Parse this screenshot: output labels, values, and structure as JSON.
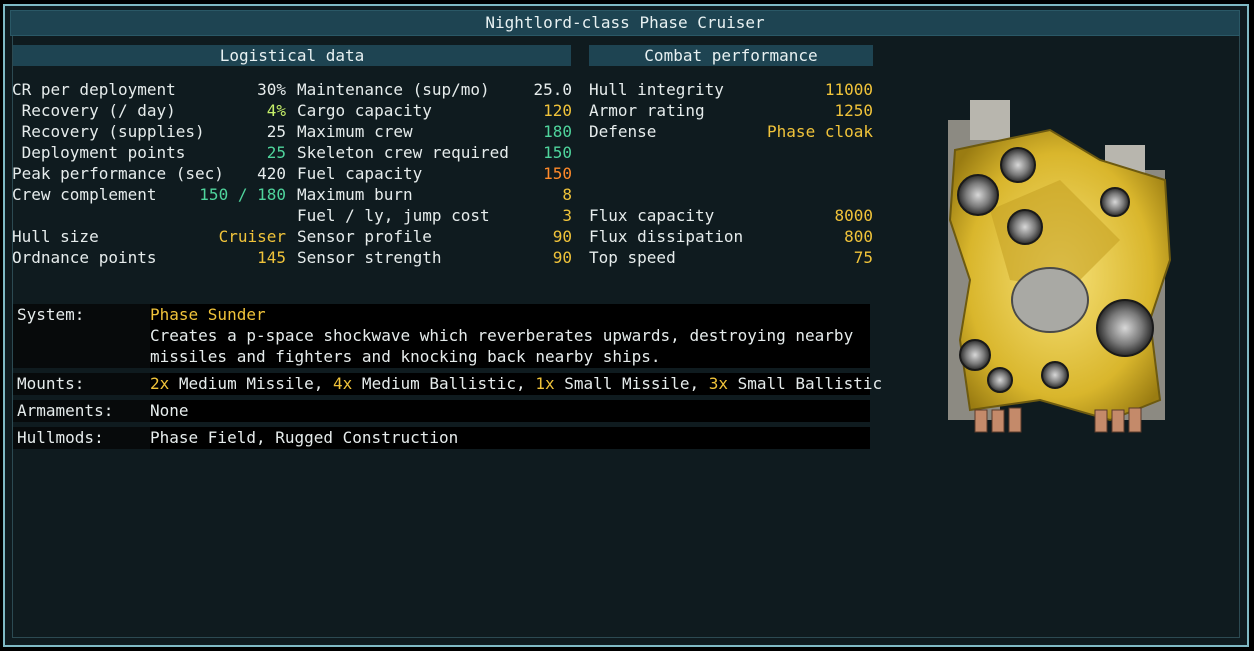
{
  "title": "Nightlord-class Phase Cruiser",
  "sections": {
    "logistical": "Logistical data",
    "combat": "Combat performance"
  },
  "col1": [
    {
      "label": "CR per deployment",
      "value": "30%",
      "color": "white"
    },
    {
      "label": " Recovery (/ day)",
      "value": "4%",
      "color": "lime"
    },
    {
      "label": " Recovery (supplies)",
      "value": "25",
      "color": "white"
    },
    {
      "label": " Deployment points",
      "value": "25",
      "color": "green"
    },
    {
      "label": "Peak performance (sec)",
      "value": "420",
      "color": "white"
    },
    {
      "label": "Crew complement",
      "value": "150 / 180",
      "color": "green"
    },
    {
      "label": "",
      "value": "",
      "color": "white"
    },
    {
      "label": "Hull size",
      "value": "Cruiser",
      "color": "yellow"
    },
    {
      "label": "Ordnance points",
      "value": "145",
      "color": "yellow"
    }
  ],
  "col2": [
    {
      "label": "Maintenance (sup/mo)",
      "value": "25.0",
      "color": "white"
    },
    {
      "label": "Cargo capacity",
      "value": "120",
      "color": "yellow"
    },
    {
      "label": "Maximum crew",
      "value": "180",
      "color": "green"
    },
    {
      "label": "Skeleton crew required",
      "value": "150",
      "color": "green"
    },
    {
      "label": "Fuel capacity",
      "value": "150",
      "color": "orange"
    },
    {
      "label": "Maximum burn",
      "value": "8",
      "color": "yellow"
    },
    {
      "label": "Fuel / ly, jump cost",
      "value": "3",
      "color": "yellow"
    },
    {
      "label": "Sensor profile",
      "value": "90",
      "color": "yellow"
    },
    {
      "label": "Sensor strength",
      "value": "90",
      "color": "yellow"
    }
  ],
  "col3": [
    {
      "label": "Hull integrity",
      "value": "11000",
      "color": "yellow"
    },
    {
      "label": "Armor rating",
      "value": "1250",
      "color": "yellow"
    },
    {
      "label": "Defense",
      "value": "Phase cloak",
      "color": "yellow"
    },
    {
      "label": "",
      "value": "",
      "color": "white"
    },
    {
      "label": "",
      "value": "",
      "color": "white"
    },
    {
      "label": "",
      "value": "",
      "color": "white"
    },
    {
      "label": "Flux capacity",
      "value": "8000",
      "color": "yellow"
    },
    {
      "label": "Flux dissipation",
      "value": "800",
      "color": "yellow"
    },
    {
      "label": "Top speed",
      "value": "75",
      "color": "yellow"
    }
  ],
  "system": {
    "label": "System:",
    "name": "Phase Sunder",
    "desc1": "Creates a p-space shockwave which reverberates upwards, destroying nearby",
    "desc2": "missiles and fighters and knocking back nearby ships."
  },
  "mounts": {
    "label": "Mounts:",
    "items": [
      {
        "count": "2x",
        "text": " Medium Missile, "
      },
      {
        "count": "4x",
        "text": " Medium Ballistic, "
      },
      {
        "count": "1x",
        "text": " Small Missile, "
      },
      {
        "count": "3x",
        "text": " Small Ballistic"
      }
    ]
  },
  "armaments": {
    "label": "Armaments:",
    "value": "None"
  },
  "hullmods": {
    "label": "Hullmods:",
    "value": "Phase Field, Rugged Construction"
  },
  "colors": {
    "yellow": "#f0c33a",
    "green": "#4fd49c",
    "orange": "#ff8a2a",
    "lime": "#c6f06a",
    "header_bg": "#1e4452",
    "frame": "#7fb9c4"
  }
}
